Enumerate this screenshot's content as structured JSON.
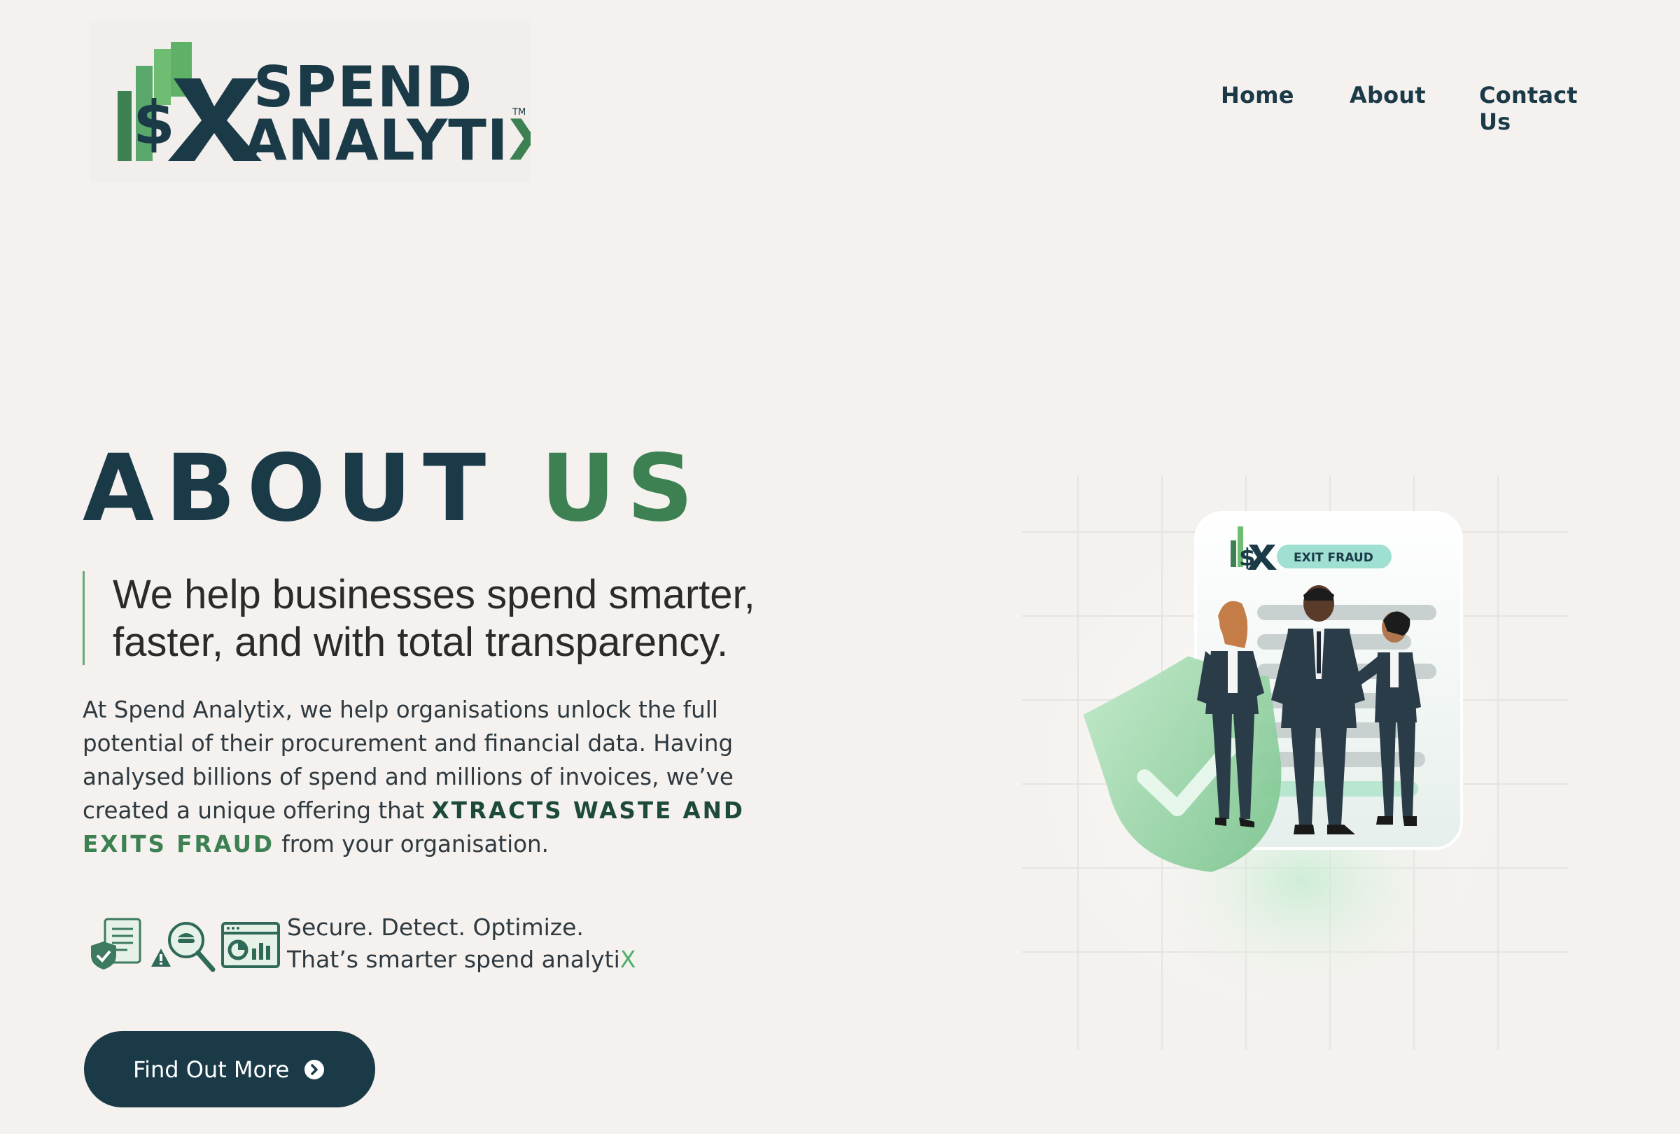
{
  "brand": {
    "line1": "SPEND",
    "line2_main": "ANALYTI",
    "line2_x": "X",
    "tm": "TM"
  },
  "nav": {
    "items": [
      "Home",
      "About",
      "Contact Us"
    ]
  },
  "hero": {
    "heading_word1": "ABOUT",
    "heading_word2": "US",
    "tagline_line1": "We help businesses spend smarter,",
    "tagline_line2": "faster, and with total transparency.",
    "body_before": "At Spend Analytix, we help organisations unlock the full potential of their procurement and financial data. Having analysed billions of spend and millions of invoices, we’ve created a unique offering that ",
    "highlight_part1": "XTRACTS WASTE AND ",
    "highlight_part2": "EXITS FRAUD",
    "body_after": " from your organisation.",
    "motto_line1": "Secure. Detect. Optimize.",
    "motto_line2_main": "That’s smarter spend analyti",
    "motto_line2_x": "X",
    "cta_label": "Find Out More"
  },
  "illustration": {
    "badge_label": "EXIT FRAUD"
  },
  "colors": {
    "background": "#f4f1ee",
    "navy": "#1b3a48",
    "green": "#3d8152",
    "light_green": "#7cc48e"
  },
  "icons": [
    "shield-document-icon",
    "fraud-detection-icon",
    "dashboard-icon",
    "chevron-right-circle-icon",
    "shield-check-icon"
  ]
}
